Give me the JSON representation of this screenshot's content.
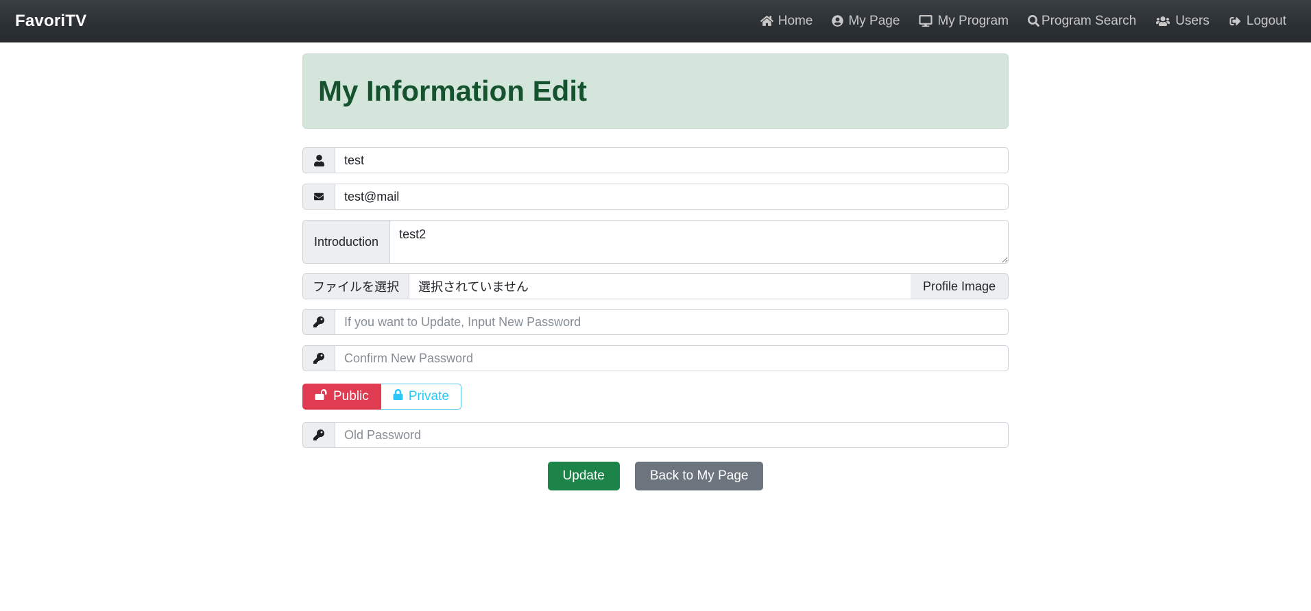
{
  "navbar": {
    "brand": "FavoriTV",
    "links": [
      {
        "label": "Home",
        "icon": "home-icon"
      },
      {
        "label": "My Page",
        "icon": "user-circle-icon"
      },
      {
        "label": "My Program",
        "icon": "desktop-icon"
      },
      {
        "label": "Program Search",
        "icon": "search-icon"
      },
      {
        "label": "Users",
        "icon": "users-icon"
      },
      {
        "label": "Logout",
        "icon": "logout-icon"
      }
    ],
    "colors": {
      "bg_top": "#3a3f44",
      "bg_bottom": "#272b30",
      "link": "#c8c8c8"
    }
  },
  "panel": {
    "title": "My Information Edit",
    "bg": "#d4e5db",
    "text_color": "#14532d"
  },
  "form": {
    "name": {
      "icon": "user-icon",
      "value": "test",
      "placeholder": ""
    },
    "email": {
      "icon": "envelope-icon",
      "value": "test@mail",
      "placeholder": ""
    },
    "introduction": {
      "label": "Introduction",
      "value": "test2",
      "placeholder": ""
    },
    "profile_image": {
      "choose_button": "ファイルを選択",
      "file_status": "選択されていません",
      "addon_label": "Profile Image"
    },
    "new_password": {
      "icon": "key-icon",
      "value": "",
      "placeholder": "If you want to Update, Input New Password"
    },
    "confirm_password": {
      "icon": "key-icon",
      "value": "",
      "placeholder": "Confirm New Password"
    },
    "visibility": {
      "public": {
        "label": "Public",
        "icon": "unlock-icon",
        "selected": true,
        "color": "#e03b50"
      },
      "private": {
        "label": "Private",
        "icon": "lock-icon",
        "selected": false,
        "color": "#2cc7f7"
      }
    },
    "old_password": {
      "icon": "key-icon",
      "value": "",
      "placeholder": "Old Password"
    }
  },
  "actions": {
    "update": {
      "label": "Update",
      "color": "#1c8449"
    },
    "back": {
      "label": "Back to My Page",
      "color": "#6c757d"
    }
  }
}
